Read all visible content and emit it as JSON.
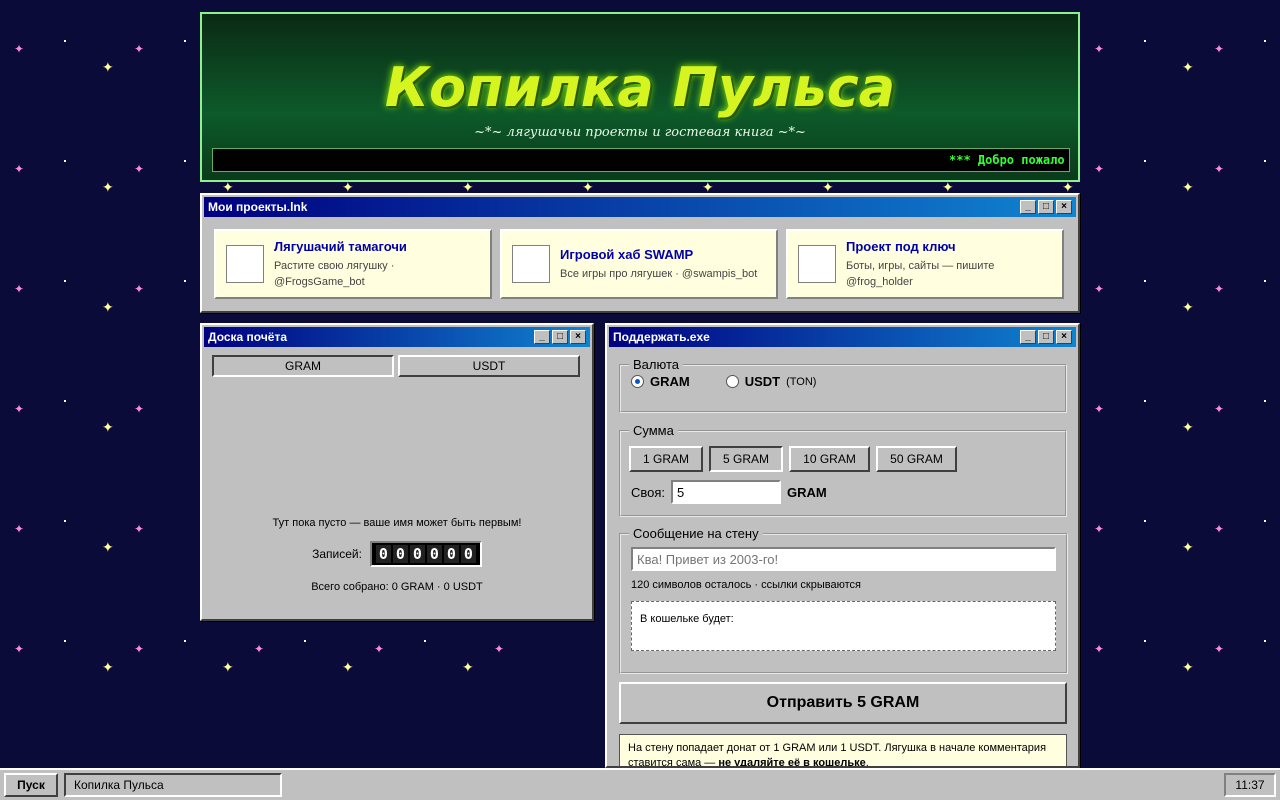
{
  "banner": {
    "icons": "     ",
    "title": "Копилка Пульса",
    "subtitle": "~*~ лягушачьи проекты и гостевая книга ~*~",
    "marquee": "*** Добро пожало"
  },
  "projects_window": {
    "title": " Мои проекты.lnk",
    "items": [
      {
        "icon": "",
        "title": "Лягушачий тамагочи",
        "desc": "Растите свою лягушку · @FrogsGame_bot"
      },
      {
        "icon": "",
        "title": "Игровой хаб SWAMP",
        "desc": "Все игры про лягушек · @swampis_bot"
      },
      {
        "icon": "",
        "title": "Проект под ключ",
        "desc": "Боты, игры, сайты — пишите @frog_holder"
      }
    ]
  },
  "honor_window": {
    "title": " Доска почёта",
    "tabs": [
      "GRAM",
      "USDT"
    ],
    "empty_text": "Тут пока пусто — ваше имя может быть первым!",
    "records_label": "Записей:",
    "counter_digits": [
      "0",
      "0",
      "0",
      "0",
      "0",
      "0"
    ],
    "total": "Всего собрано: 0 GRAM · 0 USDT"
  },
  "support_window": {
    "title": " Поддержать.exe",
    "currency_legend": "Валюта",
    "currency_gram": "GRAM",
    "currency_usdt": "USDT",
    "currency_usdt_note": "(TON)",
    "amount_legend": "Сумма",
    "amount_options": [
      "1 GRAM",
      "5 GRAM",
      "10 GRAM",
      "50 GRAM"
    ],
    "own_label": "Своя:",
    "own_value": "5",
    "own_unit": "GRAM",
    "message_legend": "Сообщение на стену",
    "message_placeholder": "Ква! Привет из 2003-го!",
    "chars_left": "120 символов осталось · ссылки скрываются",
    "wallet_label": "В кошельке будет:",
    "wallet_value": "",
    "send_label": "Отправить 5 GRAM",
    "note_text": " На стену попадает донат от 1 GRAM или 1 USDT. Лягушка  в начале комментария ставится сама — ",
    "note_bold": "не удаляйте её в кошельке",
    "note_end": "."
  },
  "taskbar": {
    "start": " Пуск",
    "task": " Копилка Пульса",
    "clock": "11:37"
  },
  "colors": {
    "background": "#0b0b3a",
    "titlebar": "#000080",
    "banner_title": "#d6f520",
    "marquee_text": "#33ff33"
  }
}
